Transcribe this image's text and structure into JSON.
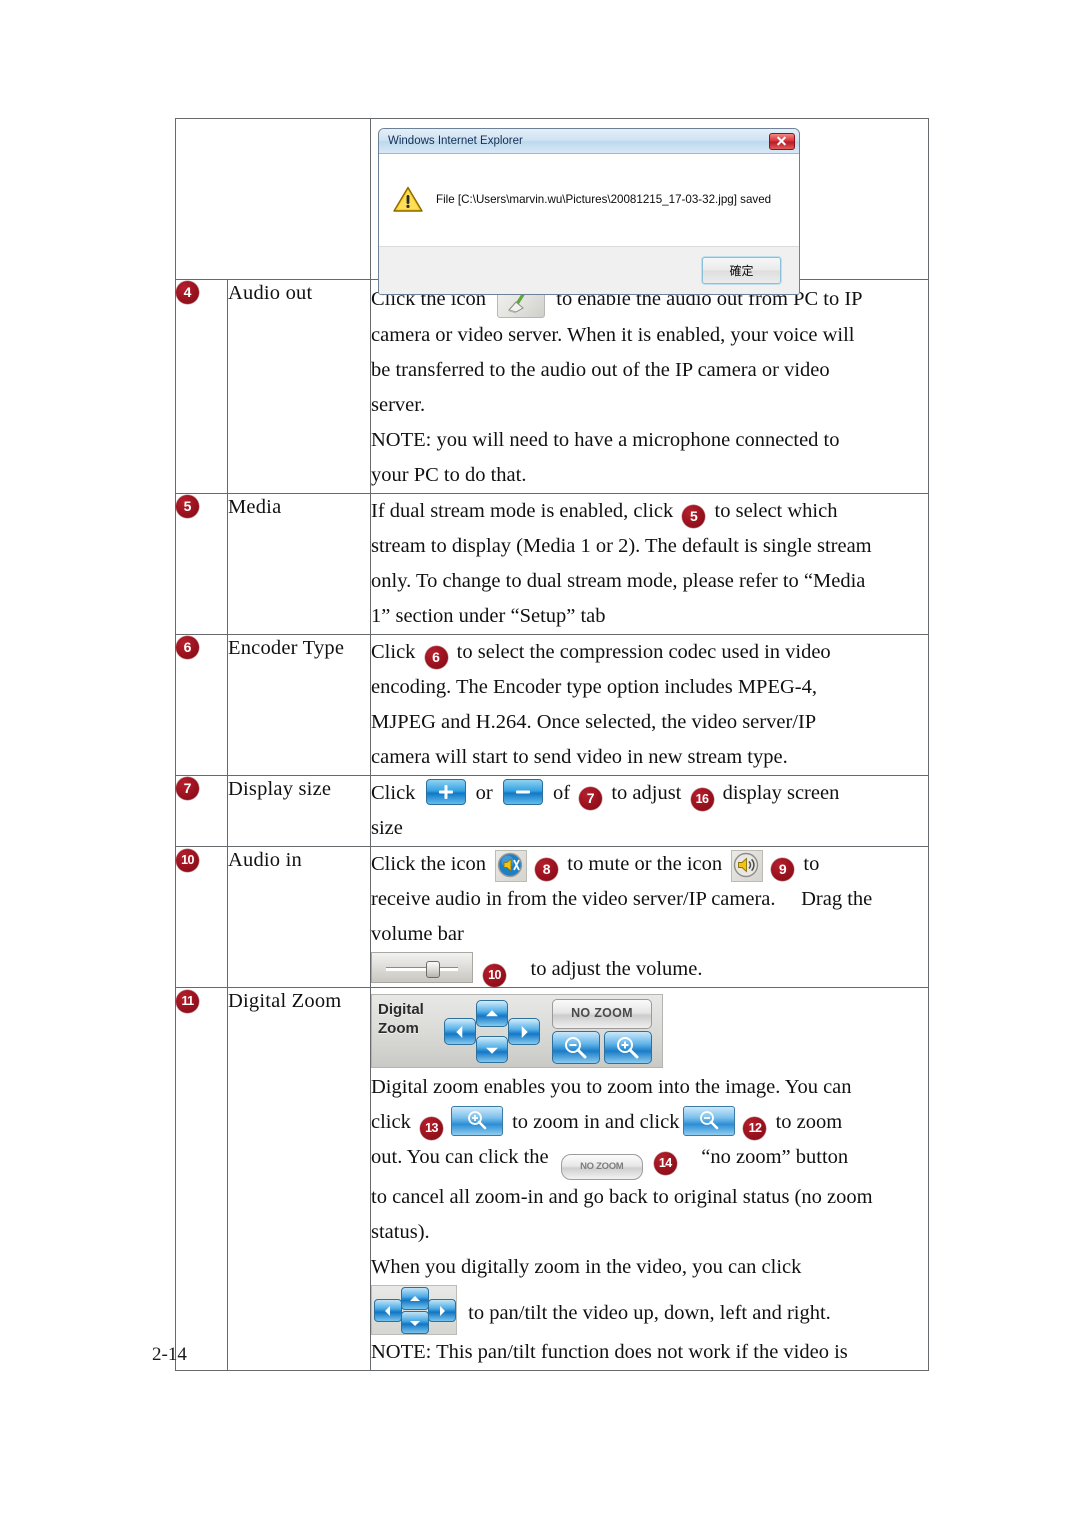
{
  "page": {
    "number": "2-14"
  },
  "dialog": {
    "title": "Windows Internet Explorer",
    "message": "File [C:\\Users\\marvin.wu\\Pictures\\20081215_17-03-32.jpg] saved",
    "ok_label": "確定",
    "close_label": "Close",
    "icon": "warning-triangle-icon"
  },
  "table": {
    "rows": [
      {
        "badge": "4",
        "name": "Audio out",
        "lines": [
          "Click the icon ",
          " to enable the audio out from PC to IP",
          "camera or video server. When it is enabled, your voice will",
          "be transferred to the audio out of the IP camera or video",
          "server.",
          "NOTE: you will need to have a microphone connected to",
          "your PC to do that."
        ]
      },
      {
        "badge": "5",
        "name": "Media",
        "lines": [
          "If dual stream mode is enabled, click ",
          " to select which",
          "stream to display (Media 1 or 2). The default is single stream",
          "only. To change to dual stream mode, please refer to “Media",
          "1” section under “Setup” tab"
        ]
      },
      {
        "badge": "6",
        "name": "Encoder Type",
        "lines": [
          "Click ",
          " to select the compression codec used in video",
          "encoding. The Encoder type option includes MPEG-4,",
          "MJPEG and H.264. Once selected, the video server/IP",
          "camera will start to send video in new stream type."
        ]
      },
      {
        "badge": "7",
        "name": "Display size",
        "lines": [
          "Click ",
          " or ",
          " of ",
          " to adjust ",
          " display screen",
          "size"
        ]
      },
      {
        "badge": "10",
        "name": "Audio in",
        "lines": [
          "Click the icon ",
          " to mute or the icon ",
          " to",
          "receive audio in from the video server/IP camera.　 Drag the",
          "volume bar",
          " to adjust the volume."
        ]
      },
      {
        "badge": "11",
        "name": "Digital Zoom",
        "lines": [
          "Digital zoom enables you to zoom into the image. You can",
          "click ",
          " to zoom in and click",
          " to zoom",
          "out. You can click the ",
          " “no zoom” button",
          "to cancel all zoom-in and go back to original status (no zoom",
          "status).",
          "When you digitally zoom in the video, you can click",
          " to pan/tilt the video up, down, left and right.",
          "NOTE: This pan/tilt function does not work if the video is"
        ]
      }
    ]
  },
  "inline_badges": {
    "media_select": "5",
    "encoder_select": "6",
    "display_size_7": "7",
    "display_size_16": "16",
    "mute": "8",
    "unmute": "9",
    "volume_bar": "10",
    "zoom_in": "13",
    "zoom_out": "12",
    "no_zoom": "14"
  },
  "widgets": {
    "digital_zoom_panel": {
      "label_line1": "Digital",
      "label_line2": "Zoom",
      "no_zoom_label": "NO ZOOM",
      "up": "up-arrow-button",
      "down": "down-arrow-button",
      "left": "left-arrow-button",
      "right": "right-arrow-button",
      "zoom_in": "zoom-in-button",
      "zoom_out": "zoom-out-button"
    },
    "no_zoom_inline_label": "NO ZOOM"
  },
  "colors": {
    "badge_red": "#99121e",
    "button_blue": "#1477c6",
    "border_gray": "#666a6d",
    "title_bar_blue": "#cfe2f2"
  }
}
